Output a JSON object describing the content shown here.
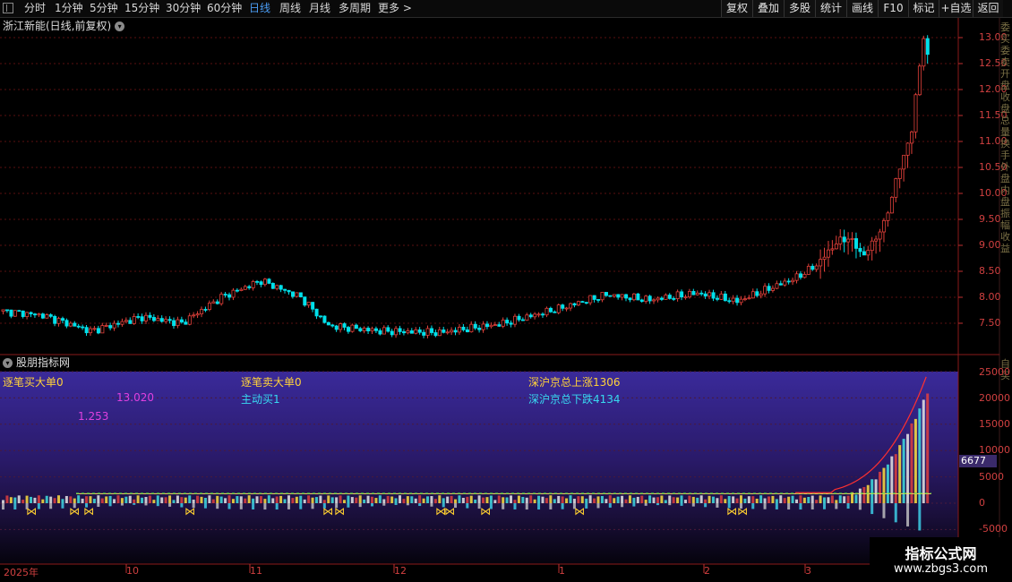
{
  "toolbar": {
    "periods": [
      "分时",
      "1分钟",
      "5分钟",
      "15分钟",
      "30分钟",
      "60分钟",
      "日线",
      "周线",
      "月线",
      "多周期",
      "更多 >"
    ],
    "active_period": "日线",
    "buttons": [
      "复权",
      "叠加",
      "多股",
      "统计",
      "画线",
      "F10",
      "标记",
      "+自选",
      "返回"
    ]
  },
  "title": "浙江新能(日线,前复权)",
  "price_axis": [
    "13.00",
    "12.50",
    "12.00",
    "11.50",
    "11.00",
    "10.50",
    "10.00",
    "9.50",
    "9.00",
    "8.50",
    "8.00",
    "7.50"
  ],
  "indicator": {
    "name": "股朋指标网",
    "label_a": "逐笔买大单0",
    "label_b": "逐笔卖大单0",
    "label_c": "主动买1",
    "label_d": "深沪京总上涨1306",
    "label_e": "深沪京总下跌4134",
    "val_1": "13.020",
    "val_2": "1.253",
    "axis": [
      "25000",
      "20000",
      "15000",
      "10000",
      "5000",
      "0",
      "-5000"
    ],
    "current_value": "6677"
  },
  "dates": [
    "2025年",
    "10",
    "11",
    "12",
    "1",
    "2",
    "3"
  ],
  "side_labels": [
    "委买",
    "委卖",
    "开盘",
    "收盘",
    "总量",
    "换手",
    "外盘",
    "内盘",
    "振幅",
    "收益",
    "自",
    "买"
  ],
  "watermark": {
    "title": "指标公式网",
    "url": "www.zbgs3.com"
  },
  "colors": {
    "up": "#e0403a",
    "down": "#00e0ea",
    "ma": "#c0c0c0",
    "grid": "#5a1010"
  }
}
